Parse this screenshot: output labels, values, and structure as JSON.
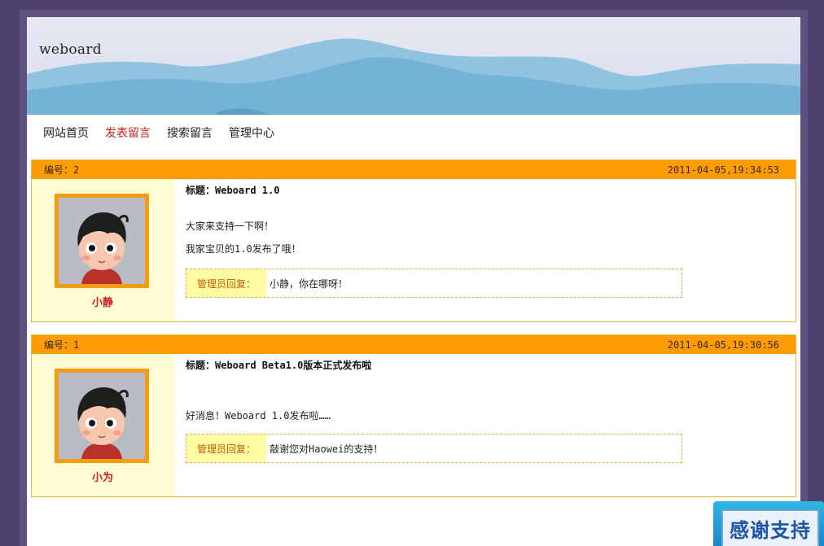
{
  "site": {
    "title": "weboard"
  },
  "nav": [
    {
      "label": "网站首页",
      "active": false
    },
    {
      "label": "发表留言",
      "active": true
    },
    {
      "label": "搜索留言",
      "active": false
    },
    {
      "label": "管理中心",
      "active": false
    }
  ],
  "posts": [
    {
      "number_label": "编号：2",
      "datetime": "2011-04-05,19:34:53",
      "author": "小静",
      "title": "标题：Weboard 1.0",
      "lines": [
        "大家来支持一下啊！",
        "我家宝贝的1.0发布了哦！"
      ],
      "reply_label": "管理员回复：",
      "reply_text": "小静，你在哪呀！"
    },
    {
      "number_label": "编号：1",
      "datetime": "2011-04-05,19:30:56",
      "author": "小为",
      "title": "标题：Weboard Beta1.0版本正式发布啦",
      "lines": [
        "好消息！Weboard 1.0发布啦……"
      ],
      "reply_label": "管理员回复：",
      "reply_text": "敲谢您对Haowei的支持！"
    }
  ],
  "thanks_button": {
    "label": "感谢支持"
  },
  "colors": {
    "header_bar": "#fe9b05",
    "accent_red": "#cc1f1f",
    "avatar_bg": "#fffdd3"
  },
  "icons": {
    "avatar": "cartoon-boy-avatar-icon"
  }
}
